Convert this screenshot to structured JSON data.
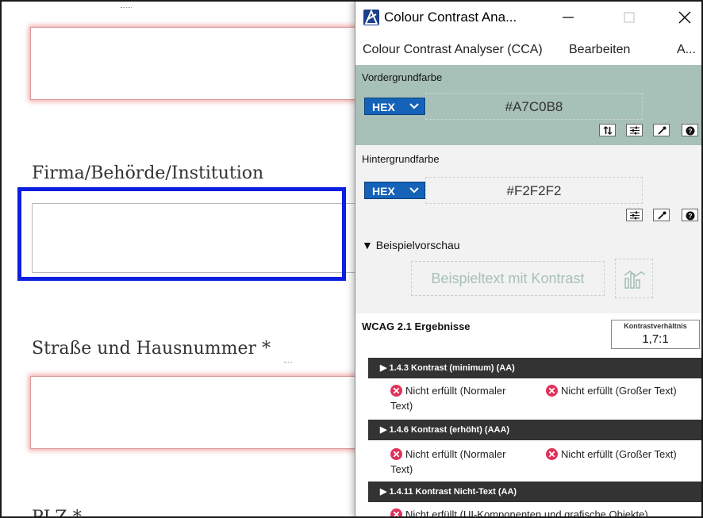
{
  "form": {
    "labels": {
      "company": "Firma/Behörde/Institution",
      "street": "Straße und Hausnummer *",
      "zip": "PLZ *"
    }
  },
  "window": {
    "title": "Colour Contrast Ana...",
    "menu": [
      "Colour Contrast Analyser (CCA)",
      "Bearbeiten",
      "A..."
    ]
  },
  "foreground": {
    "title": "Vordergrundfarbe",
    "format": "HEX",
    "value": "#A7C0B8",
    "color": "#a7c0b8"
  },
  "background": {
    "title": "Hintergrundfarbe",
    "format": "HEX",
    "value": "#F2F2F2",
    "color": "#f2f2f2"
  },
  "preview": {
    "title": "▼ Beispielvorschau",
    "text": "Beispieltext mit Kontrast"
  },
  "results": {
    "title": "WCAG 2.1 Ergebnisse",
    "ratio_label": "Kontrastverhältnis",
    "ratio": "1,7:1",
    "criteria": [
      {
        "label": "▶ 1.4.3 Kontrast (minimum) (AA)",
        "normal_a": "Nicht erfüllt (Normaler",
        "normal_b": "Text)",
        "large": "Nicht erfüllt (Großer Text)"
      },
      {
        "label": "▶ 1.4.6 Kontrast (erhöht) (AAA)",
        "normal_a": "Nicht erfüllt (Normaler",
        "normal_b": "Text)",
        "large": "Nicht erfüllt (Großer Text)"
      },
      {
        "label": "▶ 1.4.11 Kontrast Nicht-Text (AA)",
        "ui": "Nicht erfüllt (UI-Komponenten und grafische Objekte)"
      }
    ]
  },
  "icons": {
    "app": "contrast-analyser-icon",
    "minimize": "minimize-icon",
    "maximize": "maximize-icon",
    "close": "close-icon",
    "dropdown": "chevron-down-icon",
    "swap": "swap-icon",
    "sliders": "sliders-icon",
    "eyedropper": "eyedropper-icon",
    "help": "help-icon",
    "chart": "chart-icon",
    "fail": "fail-icon"
  },
  "colors": {
    "focus": "#0a1fe0",
    "error_glow": "#e66464",
    "hex_button": "#1463b8",
    "criterion_bar": "#333333",
    "fail": "#e0325b"
  }
}
